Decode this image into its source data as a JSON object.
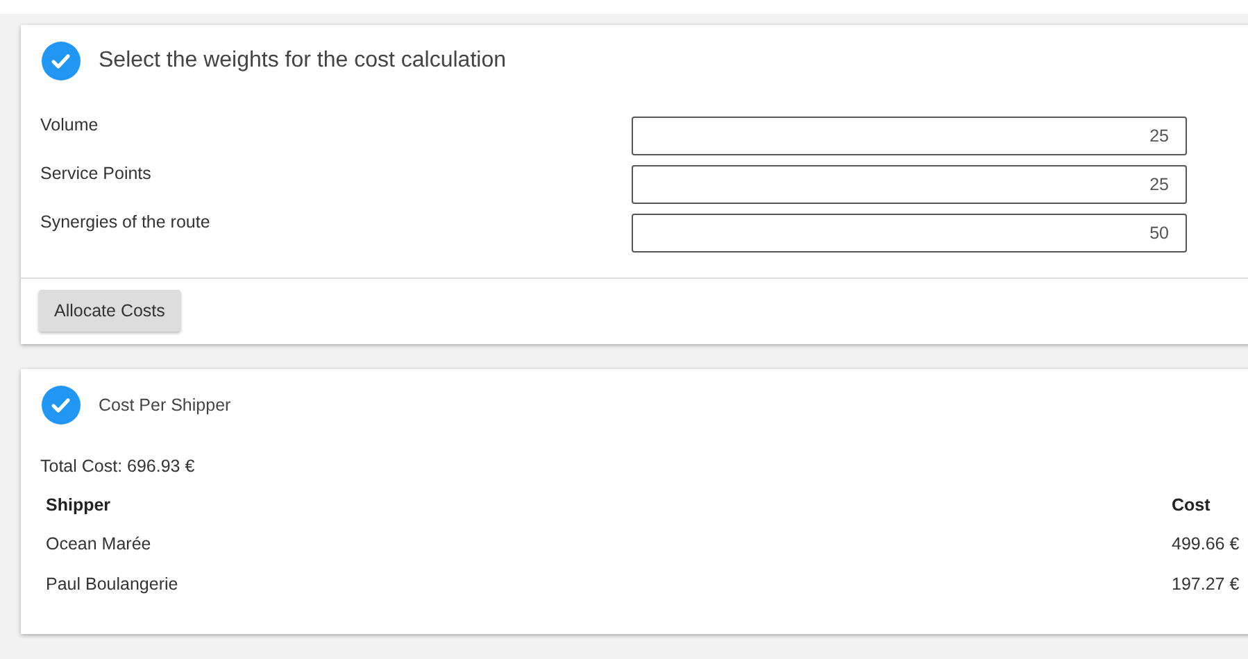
{
  "weights_card": {
    "title": "Select the weights for the cost calculation",
    "done": true,
    "fields": [
      {
        "label": "Volume",
        "value": "25"
      },
      {
        "label": "Service Points",
        "value": "25"
      },
      {
        "label": "Synergies of the route",
        "value": "50"
      }
    ],
    "button": "Allocate Costs"
  },
  "result_card": {
    "title": "Cost Per Shipper",
    "done": true,
    "total": "Total Cost: 696.93 €",
    "table": {
      "columns": [
        "Shipper",
        "Cost"
      ],
      "rows": [
        [
          "Ocean Marée",
          "499.66 €"
        ],
        [
          "Paul Boulangerie",
          "197.27 €"
        ]
      ]
    }
  }
}
